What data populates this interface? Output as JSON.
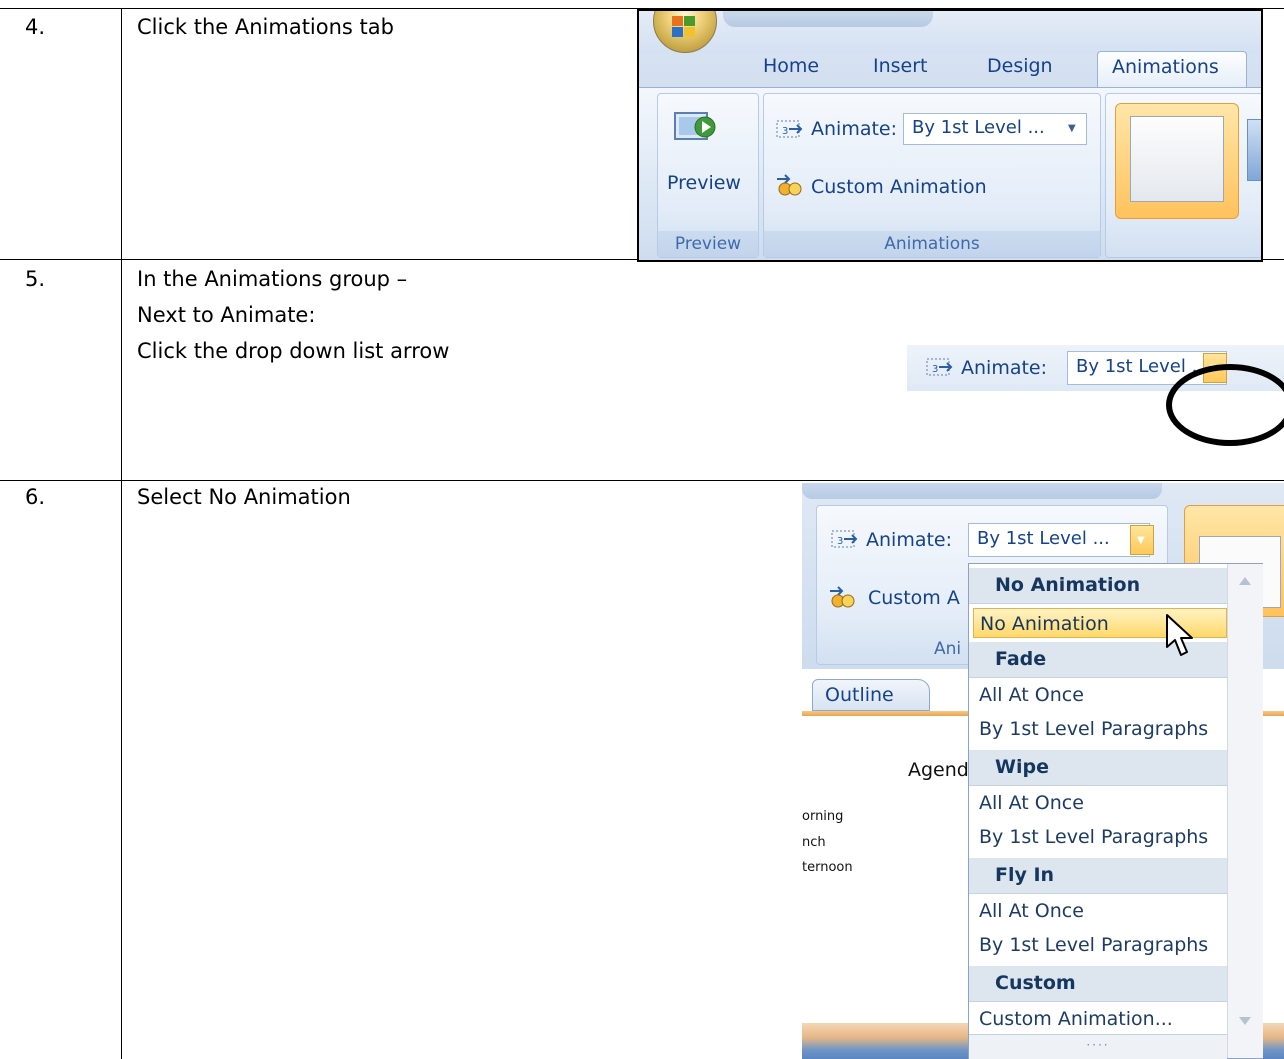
{
  "rows": [
    {
      "number": "4.",
      "lines": [
        "Click the Animations tab"
      ]
    },
    {
      "number": "5.",
      "lines": [
        "In the Animations group –",
        "Next to Animate:",
        "Click the drop down list arrow"
      ]
    },
    {
      "number": "6.",
      "lines": [
        "Select No Animation"
      ]
    }
  ],
  "shot1": {
    "tabs": [
      "Home",
      "Insert",
      "Design",
      "Animations"
    ],
    "active_tab": "Animations",
    "preview_button": "Preview",
    "preview_group": "Preview",
    "animate_label": "Animate:",
    "animate_value": "By 1st Level ...",
    "custom_animation": "Custom Animation",
    "animations_group": "Animations"
  },
  "shot2": {
    "animate_label": "Animate:",
    "animate_value": "By 1st Level ..."
  },
  "shot3": {
    "animate_label": "Animate:",
    "animate_value": "By 1st Level ...",
    "custom_animation_partial": "Custom A",
    "group_label_partial": "Ani",
    "outline_tab": "Outline",
    "slide_title_partial": "Agend",
    "slide_bullets": [
      "orning",
      "nch",
      "ternoon"
    ],
    "menu": [
      {
        "type": "header",
        "label": "No Animation"
      },
      {
        "type": "item",
        "label": "No Animation",
        "selected": true
      },
      {
        "type": "header",
        "label": "Fade"
      },
      {
        "type": "item",
        "label": "All At Once"
      },
      {
        "type": "item",
        "label": "By 1st Level Paragraphs"
      },
      {
        "type": "header",
        "label": "Wipe"
      },
      {
        "type": "item",
        "label": "All At Once"
      },
      {
        "type": "item",
        "label": "By 1st Level Paragraphs"
      },
      {
        "type": "header",
        "label": "Fly In"
      },
      {
        "type": "item",
        "label": "All At Once"
      },
      {
        "type": "item",
        "label": "By 1st Level Paragraphs"
      },
      {
        "type": "header",
        "label": "Custom"
      },
      {
        "type": "item",
        "label": "Custom Animation..."
      }
    ],
    "grip": "····"
  }
}
